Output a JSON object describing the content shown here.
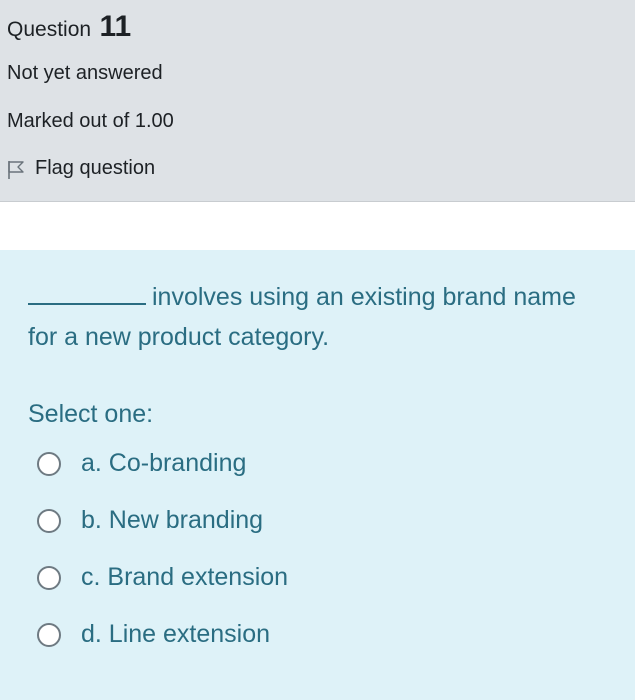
{
  "question": {
    "word": "Question",
    "number": "11",
    "state": "Not yet answered",
    "grade": "Marked out of 1.00",
    "flag_label": "Flag question"
  },
  "content": {
    "text_after_blank": "involves using an existing brand name for a new product category.",
    "prompt": "Select one:",
    "options": [
      {
        "label": "a. Co-branding",
        "selected": false
      },
      {
        "label": "b. New branding",
        "selected": false
      },
      {
        "label": "c. Brand extension",
        "selected": false
      },
      {
        "label": "d. Line extension",
        "selected": false
      }
    ]
  },
  "icons": {
    "flag": "flag-outline-icon",
    "radio": "radio-unchecked-icon"
  },
  "colors": {
    "info_bg": "#dee2e6",
    "content_bg": "#def2f8",
    "content_text": "#2a6d82",
    "info_text": "#1d2125"
  }
}
